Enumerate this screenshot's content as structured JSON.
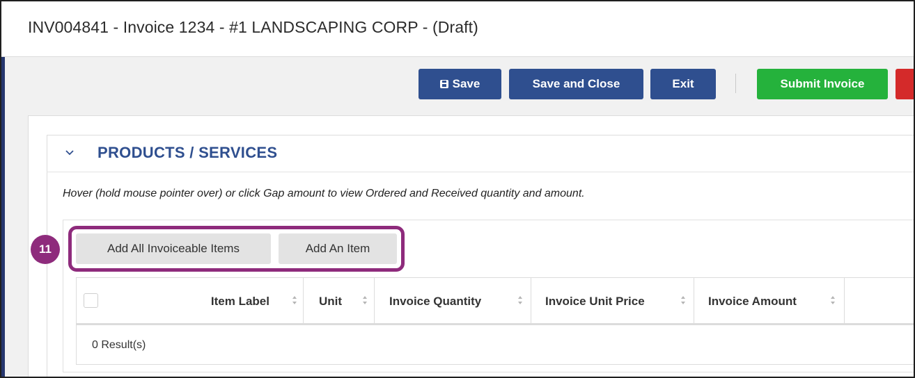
{
  "window": {
    "title": "INV004841 - Invoice 1234 - #1 LANDSCAPING CORP - (Draft)"
  },
  "toolbar": {
    "save_label": "Save",
    "save_close_label": "Save and Close",
    "exit_label": "Exit",
    "submit_label": "Submit Invoice"
  },
  "section": {
    "title": "PRODUCTS / SERVICES",
    "hint": "Hover (hold mouse pointer over) or click Gap amount to view Ordered and Received quantity and amount."
  },
  "annotation": {
    "step_number": "11"
  },
  "actions": {
    "add_all_label": "Add All Invoiceable Items",
    "add_item_label": "Add An Item"
  },
  "table": {
    "columns": [
      "Item Label",
      "Unit",
      "Invoice Quantity",
      "Invoice Unit Price",
      "Invoice Amount"
    ],
    "results_text": "0 Result(s)"
  },
  "colors": {
    "primary_blue": "#2f4f8f",
    "submit_green": "#25b23c",
    "danger_red": "#d42a2a",
    "annotation_purple": "#8e2b7c"
  }
}
